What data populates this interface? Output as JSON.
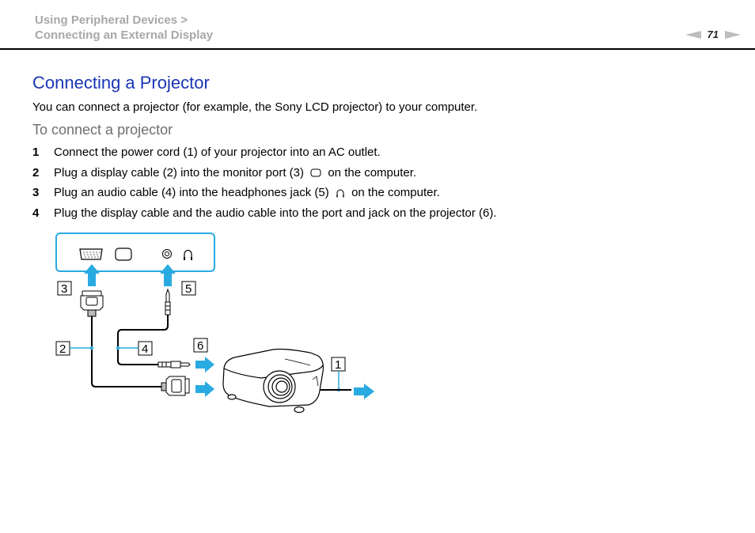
{
  "header": {
    "breadcrumb": [
      "Using Peripheral Devices >",
      "Connecting an External Display"
    ],
    "page_number": "71",
    "prev_label": "previous-page",
    "next_label": "next-page"
  },
  "content": {
    "title": "Connecting a Projector",
    "intro": "You can connect a projector (for example, the Sony LCD projector) to your computer.",
    "procedure_title": "To connect a projector",
    "steps": [
      {
        "num": "1",
        "text_before": "Connect the power cord (1) of your projector into an AC outlet.",
        "icon": "",
        "text_after": ""
      },
      {
        "num": "2",
        "text_before": "Plug a display cable (2) into the monitor port (3)",
        "icon": "monitor-port-icon",
        "text_after": "on the computer."
      },
      {
        "num": "3",
        "text_before": "Plug an audio cable (4) into the headphones jack (5)",
        "icon": "headphones-icon",
        "text_after": "on the computer."
      },
      {
        "num": "4",
        "text_before": "Plug the display cable and the audio cable into the port and jack on the projector (6).",
        "icon": "",
        "text_after": ""
      }
    ]
  },
  "diagram": {
    "callouts": [
      "1",
      "2",
      "3",
      "4",
      "5",
      "6"
    ],
    "accent_color": "#29aae1",
    "callout_color": "#1ba3dd"
  }
}
